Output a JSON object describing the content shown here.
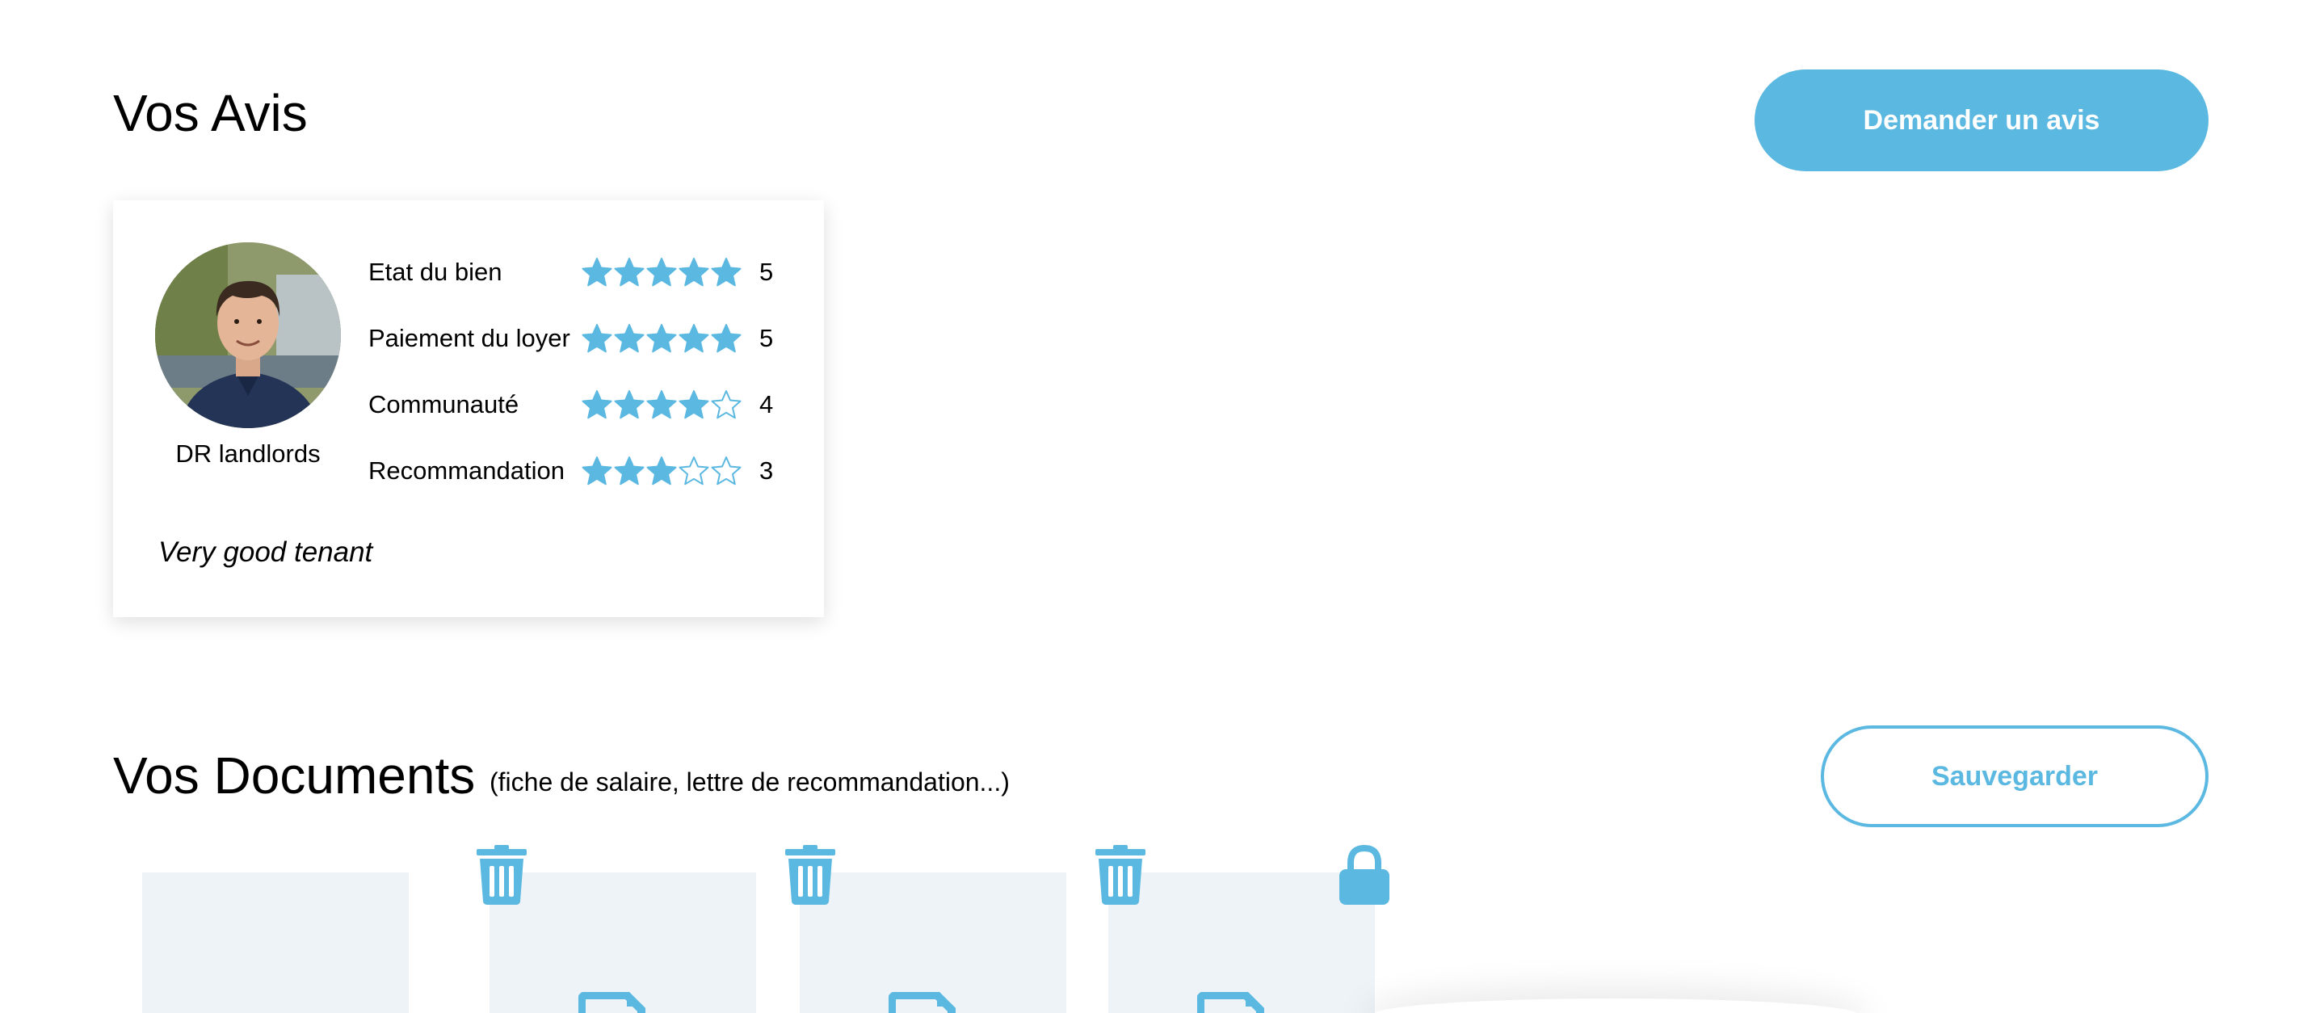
{
  "reviews": {
    "title": "Vos Avis",
    "request_button": "Demander un avis",
    "card": {
      "reviewer_name": "DR landlords",
      "criteria": [
        {
          "label": "Etat du bien",
          "rating": 5,
          "score": "5"
        },
        {
          "label": "Paiement du loyer",
          "rating": 5,
          "score": "5"
        },
        {
          "label": "Communauté",
          "rating": 4,
          "score": "4"
        },
        {
          "label": "Recommandation",
          "rating": 3,
          "score": "3"
        }
      ],
      "max_rating": 5,
      "comment": "Very good tenant"
    }
  },
  "documents": {
    "title": "Vos Documents",
    "subtitle": "(fiche de salaire, lettre de recommandation...)",
    "save_button": "Sauvegarder",
    "tiles": [
      {
        "action_icon": "none",
        "has_file_icon": false
      },
      {
        "action_icon": "trash-icon",
        "has_file_icon": true
      },
      {
        "action_icon": "trash-icon",
        "has_file_icon": true
      },
      {
        "action_icon": "trash-icon",
        "has_file_icon": true
      },
      {
        "action_icon": "lock-icon",
        "has_file_icon": false
      }
    ]
  },
  "colors": {
    "accent": "#5bb8e1",
    "tile_background": "#eef3f7"
  }
}
